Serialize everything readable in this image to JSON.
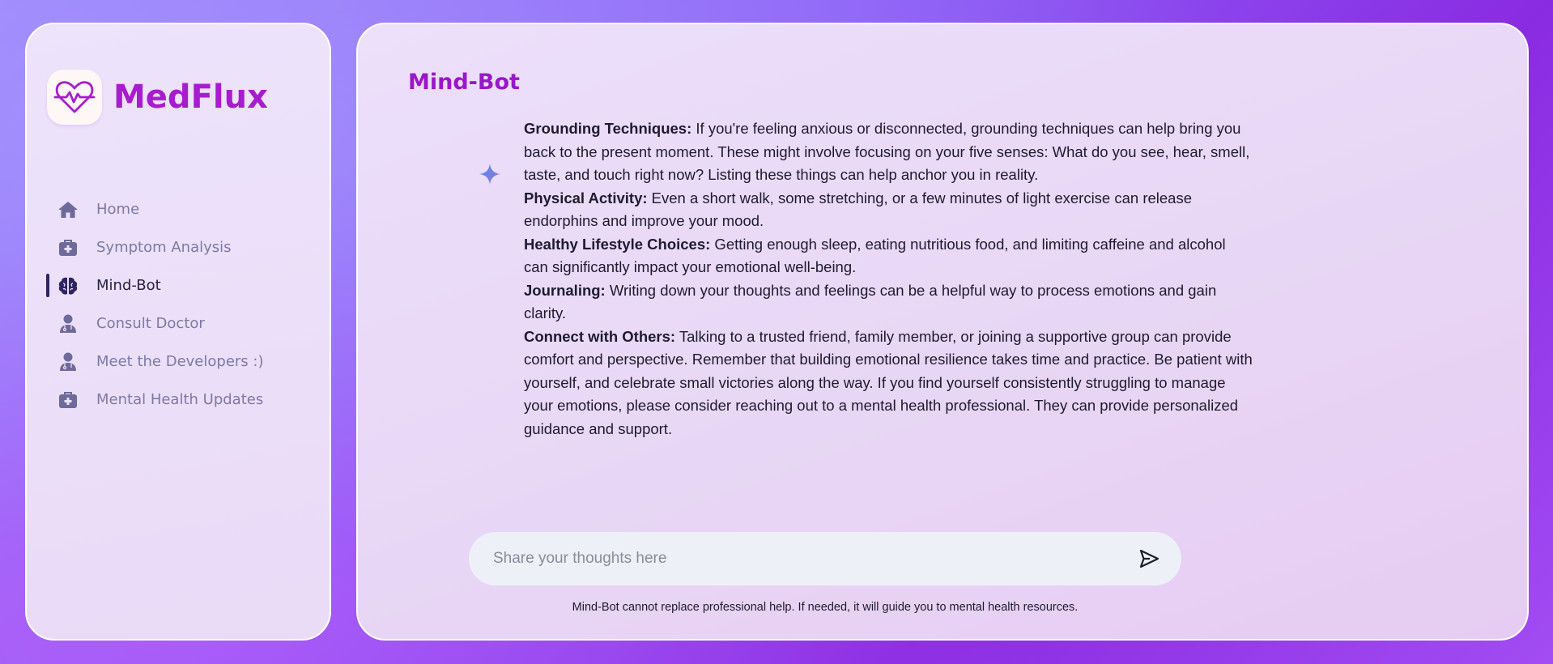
{
  "brand": {
    "name": "MedFlux",
    "logo_icon": "heart-pulse-icon"
  },
  "sidebar": {
    "items": [
      {
        "label": "Home",
        "icon": "home-icon",
        "active": false
      },
      {
        "label": "Symptom Analysis",
        "icon": "medical-kit-icon",
        "active": false
      },
      {
        "label": "Mind-Bot",
        "icon": "brain-icon",
        "active": true
      },
      {
        "label": "Consult Doctor",
        "icon": "doctor-icon",
        "active": false
      },
      {
        "label": "Meet the Developers :)",
        "icon": "doctor-icon",
        "active": false
      },
      {
        "label": "Mental Health Updates",
        "icon": "medical-kit-icon",
        "active": false
      }
    ]
  },
  "main": {
    "title": "Mind-Bot",
    "bot_icon": "sparkle-icon",
    "message": [
      {
        "heading": "Grounding Techniques:",
        "text": " If you're feeling anxious or disconnected, grounding techniques can help bring you back to the present moment. These might involve focusing on your five senses: What do you see, hear, smell, taste, and touch right now? Listing these things can help anchor you in reality."
      },
      {
        "heading": "Physical Activity:",
        "text": " Even a short walk, some stretching, or a few minutes of light exercise can release endorphins and improve your mood."
      },
      {
        "heading": "Healthy Lifestyle Choices:",
        "text": " Getting enough sleep, eating nutritious food, and limiting caffeine and alcohol can significantly impact your emotional well-being."
      },
      {
        "heading": "Journaling:",
        "text": " Writing down your thoughts and feelings can be a helpful way to process emotions and gain clarity."
      },
      {
        "heading": "Connect with Others:",
        "text": " Talking to a trusted friend, family member, or joining a supportive group can provide comfort and perspective. Remember that building emotional resilience takes time and practice. Be patient with yourself, and celebrate small victories along the way. If you find yourself consistently struggling to manage your emotions, please consider reaching out to a mental health professional. They can provide personalized guidance and support."
      }
    ],
    "input": {
      "value": "",
      "placeholder": "Share your thoughts here"
    },
    "send_icon": "send-icon",
    "disclaimer": "Mind-Bot cannot replace professional help. If needed, it will guide you to mental health resources."
  },
  "colors": {
    "brand": "#a81ccf",
    "title": "#9a17c9",
    "nav_text": "#7b7aa6",
    "nav_active": "#252248",
    "nav_icon": "#6e6a9a"
  }
}
